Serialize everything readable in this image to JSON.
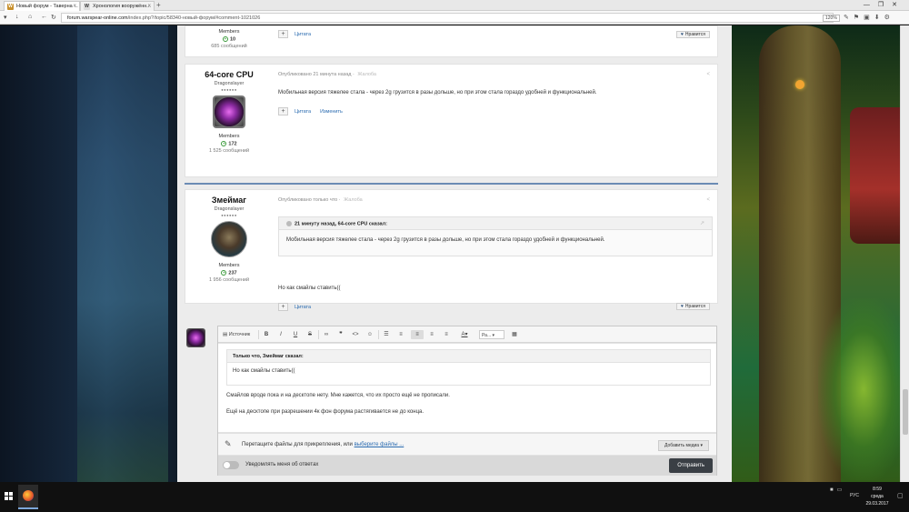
{
  "browser": {
    "tabs": [
      {
        "title": "Новый форум - Таверна ...",
        "icon": "W"
      },
      {
        "title": "Хронология вооружённ...",
        "icon": "W"
      }
    ],
    "new_tab": "+",
    "url_host": "forum.warspear-online.com",
    "url_path": "/index.php?/topic/58340-новый-форум/#comment-1021026",
    "zoom": "120%",
    "window_controls": [
      "—",
      "❐",
      "✕"
    ]
  },
  "posts": [
    {
      "author": "",
      "group": "Members",
      "reputation": "10",
      "post_count": "685 сообщений",
      "actions": [
        "Цитата"
      ],
      "like_label": "Нравится"
    },
    {
      "author": "64-core CPU",
      "rank": "Dragonslayer",
      "pips": "●●●●●●",
      "meta": "Опубликовано 21 минута назад",
      "report": "Жалоба",
      "text": "Мобильная версия тяжелее стала - через 2g грузится в разы дольше, но при этом стала гораздо удобней и функциональней.",
      "actions": [
        "Цитата",
        "Изменить"
      ],
      "group": "Members",
      "reputation": "172",
      "post_count": "1 525 сообщений"
    },
    {
      "author": "Змеймаг",
      "rank": "Dragonslayer",
      "pips": "●●●●●●",
      "meta": "Опубликовано только что",
      "report": "Жалоба",
      "quote_header": "21 минуту назад, 64-core CPU сказал:",
      "quote_text": "Мобильная версия тяжелее стала - через 2g грузится в разы дольше, но при этом стала гораздо удобней и функциональней.",
      "text": "Но как смайлы ставить((",
      "actions": [
        "Цитата"
      ],
      "like_label": "Нравится",
      "group": "Members",
      "reputation": "237",
      "post_count": "1 956 сообщений"
    }
  ],
  "editor": {
    "source_label": "Источник",
    "font_select": "Ра...",
    "quote_header": "Только что, Змеймаг сказал:",
    "quote_text": "Но как смайлы ставить((",
    "line1": "Смайлов вроде пока и на десктопе нету. Мне кажется, что их просто ещё не прописали.",
    "line2": "Ещё на десктопе при разрешении 4к фон форума растягивается не до конца.",
    "attach_text": "Перетащите файлы для прикрепления, или",
    "attach_link": "выберите файлы ...",
    "media_button": "Добавить медиа ▾",
    "notify_label": "Уведомлять меня об ответах",
    "submit_label": "Отправить"
  },
  "taskbar": {
    "lang": "РУС",
    "time": "8:59",
    "day": "среда",
    "date": "29.03.2017"
  }
}
